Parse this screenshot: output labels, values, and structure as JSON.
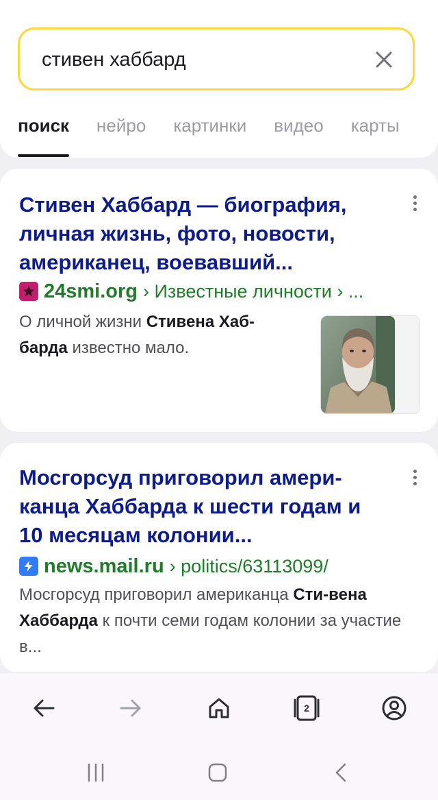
{
  "search": {
    "query": "стивен хаббард"
  },
  "tabs": [
    "поиск",
    "нейро",
    "картинки",
    "видео",
    "карты"
  ],
  "results": [
    {
      "title": "Стивен Хаббард — биография, личная жизнь, фото, новости, американец, воевавший...",
      "domain": "24smi.org",
      "path": "› Известные личности › ...",
      "snippet": {
        "pre": "О личной жизни ",
        "bold": "Стивена Хаб-барда",
        "post": " известно мало."
      },
      "favicon": "star-icon"
    },
    {
      "title": "Мосгорсуд приговорил амери-канца Хаббарда к шести годам и 10 месяцам колонии...",
      "domain": "news.mail.ru",
      "path": "› politics/63113099/",
      "snippet": {
        "pre": "Мосгорсуд приговорил американца ",
        "bold": "Сти-вена Хаббарда",
        "post": " к почти семи годам колонии за участие в..."
      },
      "favicon": "lightning-icon"
    }
  ],
  "bottom_nav": {
    "tabs_count": "2"
  },
  "colors": {
    "search_border": "#fdd83a",
    "title": "#0d1c8c",
    "url": "#1f7d2a",
    "accent_orb": "#f26b4f"
  }
}
